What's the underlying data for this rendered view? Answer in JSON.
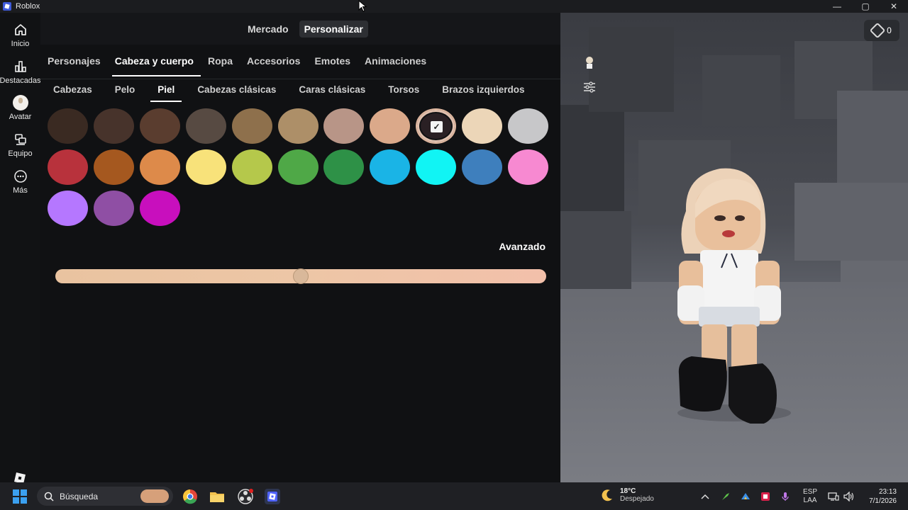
{
  "window": {
    "title": "Roblox",
    "controls": [
      "—",
      "▢",
      "✕"
    ]
  },
  "leftnav": {
    "items": [
      {
        "label": "Inicio",
        "icon": "home-icon"
      },
      {
        "label": "Destacadas",
        "icon": "chart-icon"
      },
      {
        "label": "Avatar",
        "icon": "avatar-icon"
      },
      {
        "label": "Equipo",
        "icon": "team-icon"
      },
      {
        "label": "Más",
        "icon": "more-icon"
      }
    ]
  },
  "top_tabs": [
    {
      "label": "Mercado",
      "active": false
    },
    {
      "label": "Personalizar",
      "active": true
    }
  ],
  "category_tabs": [
    {
      "label": "Personajes",
      "active": false
    },
    {
      "label": "Cabeza y cuerpo",
      "active": true
    },
    {
      "label": "Ropa",
      "active": false
    },
    {
      "label": "Accesorios",
      "active": false
    },
    {
      "label": "Emotes",
      "active": false
    },
    {
      "label": "Animaciones",
      "active": false
    }
  ],
  "sub_tabs": [
    {
      "label": "Cabezas",
      "active": false
    },
    {
      "label": "Pelo",
      "active": false
    },
    {
      "label": "Piel",
      "active": true
    },
    {
      "label": "Cabezas clásicas",
      "active": false
    },
    {
      "label": "Caras clásicas",
      "active": false
    },
    {
      "label": "Torsos",
      "active": false
    },
    {
      "label": "Brazos izquierdos",
      "active": false
    }
  ],
  "skin_colors": [
    "#3a2a22",
    "#47332b",
    "#5a3d2f",
    "#574a42",
    "#8e704c",
    "#ad8f68",
    "#b89587",
    "#dba98a",
    "#e2b69b",
    "#ecd6b8",
    "#c7c7c9",
    "#b8323c",
    "#a5581f",
    "#dd8a4a",
    "#f8e27a",
    "#b5c84b",
    "#4fa847",
    "#2e9147",
    "#1ab4e6",
    "#11f4f4",
    "#3e7fbd",
    "#f789d1",
    "#b577ff",
    "#8f4fa4",
    "#c80fbd"
  ],
  "selected_color_index": 8,
  "advanced_label": "Avanzado",
  "slider": {
    "value": 0.5
  },
  "viewport": {
    "robux_count": "0"
  },
  "taskbar": {
    "search_label": "Búsqueda",
    "weather_temp": "18°C",
    "weather_desc": "Despejado",
    "lang_top": "ESP",
    "lang_bottom": "LAA",
    "time": "23:13",
    "date": "7/1/2026"
  }
}
